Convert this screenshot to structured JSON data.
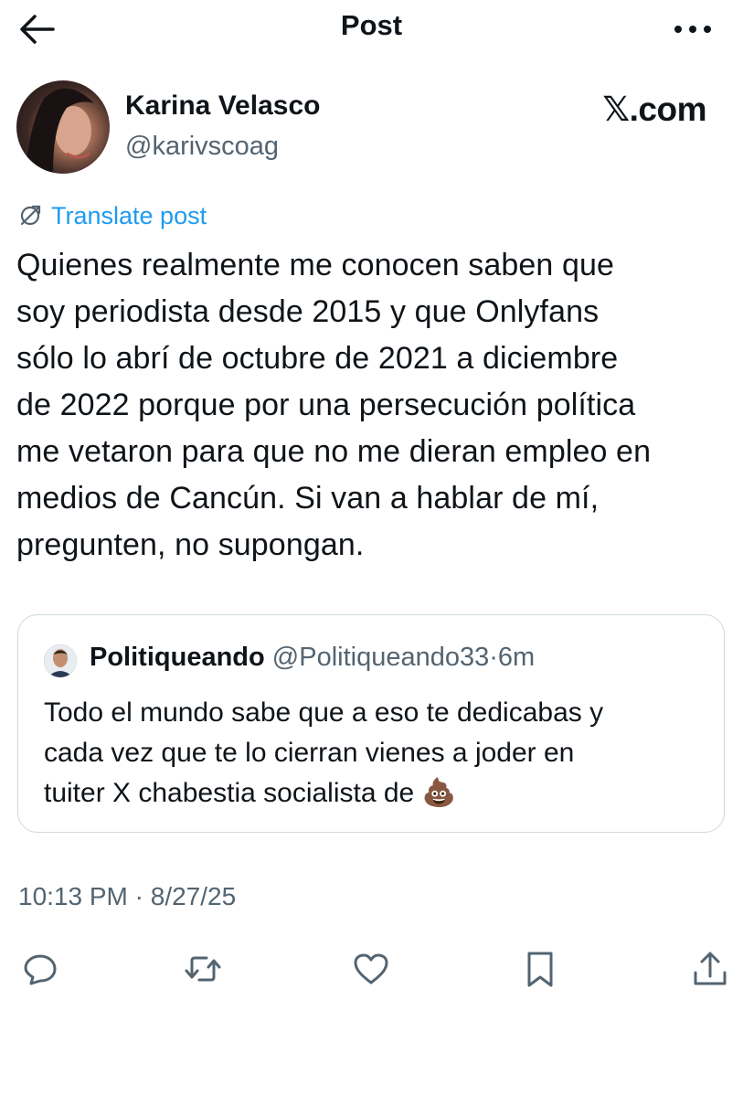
{
  "header": {
    "title": "Post",
    "back_icon": "arrow-left-icon",
    "more_icon": "more-horizontal-icon"
  },
  "author": {
    "name": "Karina Velasco",
    "handle": "@karivscoag",
    "brand": "𝕏.com"
  },
  "translate_label": "Translate post",
  "post_text": "Quienes realmente me conocen saben que\nsoy periodista desde 2015 y que Onlyfans\nsólo lo abrí de octubre de 2021 a diciembre\nde 2022 porque por una persecución política\nme vetaron para que no me dieran empleo en\nmedios de Cancún. Si van a hablar de mí,\npregunten, no supongan.",
  "quote": {
    "name": "Politiqueando",
    "handle": "@Politiqueando33",
    "separator": "·",
    "time": "6m",
    "text": "Todo el mundo sabe que a eso te dedicabas y\ncada vez que te lo cierran vienes a joder en\ntuiter X  chabestia socialista de 💩"
  },
  "timestamp": {
    "time": "10:13 PM",
    "separator": "·",
    "date": "8/27/25"
  },
  "actions": [
    "reply-icon",
    "repost-icon",
    "like-icon",
    "bookmark-icon",
    "share-icon"
  ],
  "colors": {
    "link": "#1d9bf0",
    "secondary": "#536471",
    "border": "#cfd9de",
    "text": "#0f1419"
  }
}
